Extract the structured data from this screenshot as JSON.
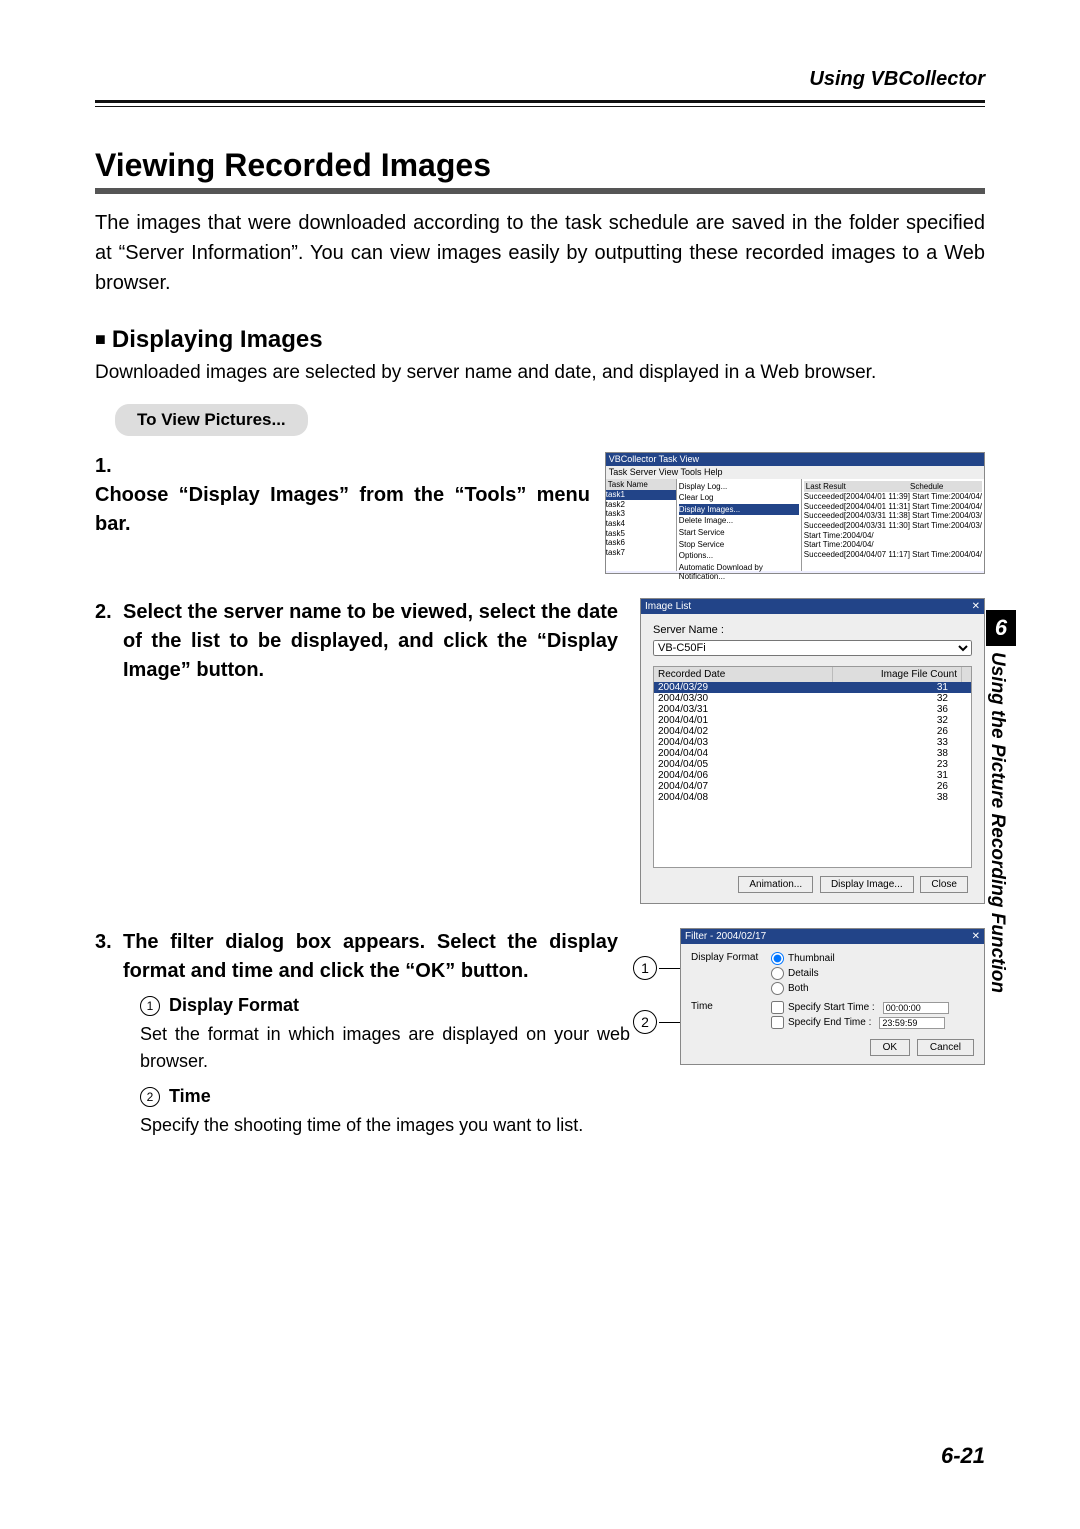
{
  "header": {
    "right": "Using VBCollector"
  },
  "h1": "Viewing Recorded Images",
  "intro": "The images that were downloaded according to the task schedule are saved in the folder specified at “Server Information”. You can view images easily by outputting these recorded images to a Web browser.",
  "h2": "Displaying Images",
  "h2_body": "Downloaded images are selected by server name and date, and displayed in a Web browser.",
  "pill": "To View Pictures...",
  "steps": {
    "s1": {
      "num": "1.",
      "text": "Choose “Display Images” from the “Tools” menu bar."
    },
    "s2": {
      "num": "2.",
      "text": "Select the server name to be viewed, select the date of the list to be displayed, and click the “Display Image” button."
    },
    "s3": {
      "num": "3.",
      "text": "The filter dialog box appears. Select the display format and time and click the “OK” button."
    }
  },
  "sub1": {
    "label": "Display Format",
    "body": "Set the format in which images are displayed on your web browser."
  },
  "sub2": {
    "label": "Time",
    "body": "Specify the shooting time of the images you want to list."
  },
  "mock1": {
    "title": "VBCollector Task View",
    "menubar": "Task  Server  View  Tools  Help",
    "col_th": {
      "task": "Task Name",
      "last": "Last Result",
      "sched": "Schedule"
    },
    "tasks": [
      "task1",
      "task2",
      "task3",
      "task4",
      "task5",
      "task6",
      "task7"
    ],
    "menu": [
      "Display Log...",
      "Clear Log",
      "Display Images...",
      "Delete Image...",
      "Start Service",
      "Stop Service",
      "Options...",
      "Automatic Download by Notification..."
    ],
    "menu_sel": "Display Images...",
    "results": [
      "Succeeded[2004/04/01 11:39]   Start Time:2004/04/",
      "Succeeded[2004/04/01 11:31]   Start Time:2004/04/",
      "Succeeded[2004/03/31 11:38]   Start Time:2004/03/",
      "Succeeded[2004/03/31 11:30]   Start Time:2004/03/",
      "                               Start Time:2004/04/",
      "                               Start Time:2004/04/",
      "Succeeded[2004/04/07 11:17]   Start Time:2004/04/"
    ]
  },
  "mock2": {
    "title": "Image List",
    "server_lbl": "Server Name :",
    "server_val": "VB-C50Fi",
    "col_date": "Recorded Date",
    "col_count": "Image File Count",
    "rows": [
      {
        "d": "2004/03/29",
        "c": "31",
        "sel": true
      },
      {
        "d": "2004/03/30",
        "c": "32"
      },
      {
        "d": "2004/03/31",
        "c": "36"
      },
      {
        "d": "2004/04/01",
        "c": "32"
      },
      {
        "d": "2004/04/02",
        "c": "26"
      },
      {
        "d": "2004/04/03",
        "c": "33"
      },
      {
        "d": "2004/04/04",
        "c": "38"
      },
      {
        "d": "2004/04/05",
        "c": "23"
      },
      {
        "d": "2004/04/06",
        "c": "31"
      },
      {
        "d": "2004/04/07",
        "c": "26"
      },
      {
        "d": "2004/04/08",
        "c": "38"
      }
    ],
    "btn_anim": "Animation...",
    "btn_disp": "Display Image...",
    "btn_close": "Close"
  },
  "mock3": {
    "title": "Filter - 2004/02/17",
    "row1_lbl": "Display Format",
    "r_thumb": "Thumbnail",
    "r_detail": "Details",
    "r_both": "Both",
    "row2_lbl": "Time",
    "chk_start": "Specify Start Time :",
    "chk_end": "Specify End Time :",
    "start_v": "00:00:00",
    "end_v": "23:59:59",
    "ok": "OK",
    "cancel": "Cancel"
  },
  "sidetab": {
    "num": "6",
    "text": "Using the Picture Recording Function"
  },
  "pagenum": "6-21"
}
